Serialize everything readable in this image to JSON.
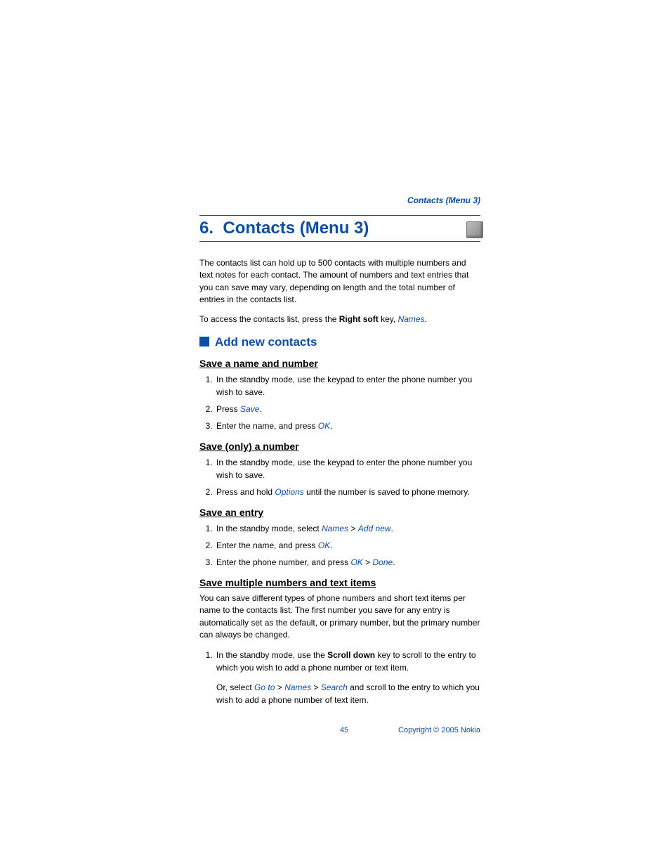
{
  "runningHead": "Contacts (Menu 3)",
  "chapter": {
    "number": "6.",
    "title": "Contacts (Menu 3)"
  },
  "intro1": "The contacts list can hold up to 500 contacts with multiple numbers and text notes for each contact. The amount of numbers and text entries that you can save may vary, depending on length and the total number of entries in the contacts list.",
  "intro2_pre": "To access the contacts list, press the ",
  "intro2_bold": "Right soft",
  "intro2_mid": " key, ",
  "intro2_link": "Names",
  "intro2_post": ".",
  "sectionTitle": "Add new contacts",
  "sub1": {
    "head": "Save a name and number",
    "step1": "In the standby mode, use the keypad to enter the phone number you wish to save.",
    "step2_pre": "Press ",
    "step2_link": "Save",
    "step2_post": ".",
    "step3_pre": "Enter the name, and press ",
    "step3_link": "OK",
    "step3_post": "."
  },
  "sub2": {
    "head": "Save (only) a number",
    "step1": "In the standby mode, use the keypad to enter the phone number you wish to save.",
    "step2_pre": "Press and hold ",
    "step2_link": "Options",
    "step2_post": " until the number is saved to phone memory."
  },
  "sub3": {
    "head": "Save an entry",
    "step1_pre": "In the standby mode, select ",
    "step1_link1": "Names",
    "step1_sep1": "  > ",
    "step1_link2": "Add new",
    "step1_post": ".",
    "step2_pre": "Enter the name, and press ",
    "step2_link": "OK",
    "step2_post": ".",
    "step3_pre": "Enter the phone number, and press ",
    "step3_link1": "OK",
    "step3_sep": " > ",
    "step3_link2": "Done",
    "step3_post": "."
  },
  "sub4": {
    "head": "Save multiple numbers and text items",
    "para": "You can save different types of phone numbers and short text items per name to the contacts list. The first number you save for any entry is automatically set as the default, or primary number, but the primary number can always be changed.",
    "step1_pre": "In the standby mode, use the ",
    "step1_bold": "Scroll down",
    "step1_post": " key to scroll to the entry to which you wish to add a phone number or text item.",
    "note_pre": "Or, select ",
    "note_link1": "Go to",
    "note_sep1": " > ",
    "note_link2": "Names",
    "note_sep2": " > ",
    "note_link3": "Search",
    "note_post": " and scroll to the entry to which you wish to add a phone number of text item."
  },
  "footer": {
    "page": "45",
    "copyright": "Copyright © 2005 Nokia"
  }
}
